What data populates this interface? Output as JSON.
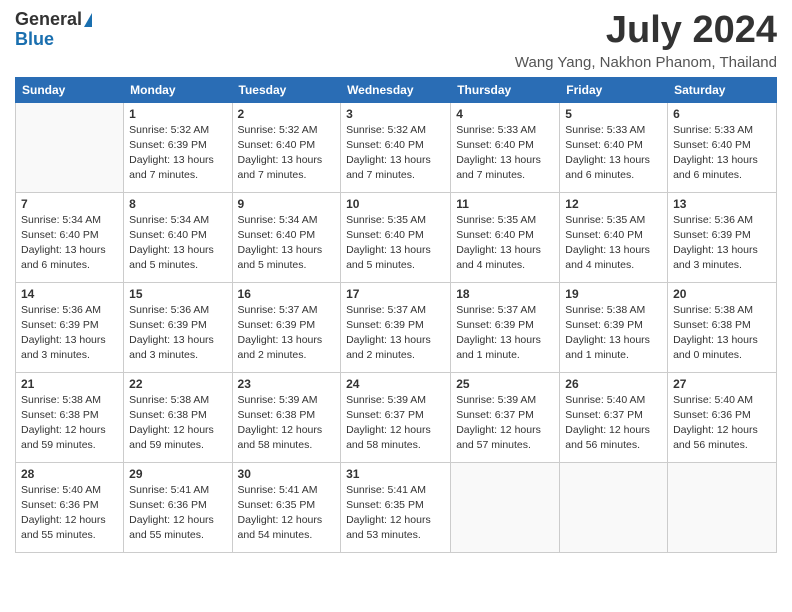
{
  "logo": {
    "general": "General",
    "blue": "Blue"
  },
  "title": {
    "month_year": "July 2024",
    "location": "Wang Yang, Nakhon Phanom, Thailand"
  },
  "weekdays": [
    "Sunday",
    "Monday",
    "Tuesday",
    "Wednesday",
    "Thursday",
    "Friday",
    "Saturday"
  ],
  "weeks": [
    [
      null,
      {
        "day": "1",
        "sunrise": "5:32 AM",
        "sunset": "6:39 PM",
        "daylight": "13 hours and 7 minutes."
      },
      {
        "day": "2",
        "sunrise": "5:32 AM",
        "sunset": "6:40 PM",
        "daylight": "13 hours and 7 minutes."
      },
      {
        "day": "3",
        "sunrise": "5:32 AM",
        "sunset": "6:40 PM",
        "daylight": "13 hours and 7 minutes."
      },
      {
        "day": "4",
        "sunrise": "5:33 AM",
        "sunset": "6:40 PM",
        "daylight": "13 hours and 7 minutes."
      },
      {
        "day": "5",
        "sunrise": "5:33 AM",
        "sunset": "6:40 PM",
        "daylight": "13 hours and 6 minutes."
      },
      {
        "day": "6",
        "sunrise": "5:33 AM",
        "sunset": "6:40 PM",
        "daylight": "13 hours and 6 minutes."
      }
    ],
    [
      {
        "day": "7",
        "sunrise": "5:34 AM",
        "sunset": "6:40 PM",
        "daylight": "13 hours and 6 minutes."
      },
      {
        "day": "8",
        "sunrise": "5:34 AM",
        "sunset": "6:40 PM",
        "daylight": "13 hours and 5 minutes."
      },
      {
        "day": "9",
        "sunrise": "5:34 AM",
        "sunset": "6:40 PM",
        "daylight": "13 hours and 5 minutes."
      },
      {
        "day": "10",
        "sunrise": "5:35 AM",
        "sunset": "6:40 PM",
        "daylight": "13 hours and 5 minutes."
      },
      {
        "day": "11",
        "sunrise": "5:35 AM",
        "sunset": "6:40 PM",
        "daylight": "13 hours and 4 minutes."
      },
      {
        "day": "12",
        "sunrise": "5:35 AM",
        "sunset": "6:40 PM",
        "daylight": "13 hours and 4 minutes."
      },
      {
        "day": "13",
        "sunrise": "5:36 AM",
        "sunset": "6:39 PM",
        "daylight": "13 hours and 3 minutes."
      }
    ],
    [
      {
        "day": "14",
        "sunrise": "5:36 AM",
        "sunset": "6:39 PM",
        "daylight": "13 hours and 3 minutes."
      },
      {
        "day": "15",
        "sunrise": "5:36 AM",
        "sunset": "6:39 PM",
        "daylight": "13 hours and 3 minutes."
      },
      {
        "day": "16",
        "sunrise": "5:37 AM",
        "sunset": "6:39 PM",
        "daylight": "13 hours and 2 minutes."
      },
      {
        "day": "17",
        "sunrise": "5:37 AM",
        "sunset": "6:39 PM",
        "daylight": "13 hours and 2 minutes."
      },
      {
        "day": "18",
        "sunrise": "5:37 AM",
        "sunset": "6:39 PM",
        "daylight": "13 hours and 1 minute."
      },
      {
        "day": "19",
        "sunrise": "5:38 AM",
        "sunset": "6:39 PM",
        "daylight": "13 hours and 1 minute."
      },
      {
        "day": "20",
        "sunrise": "5:38 AM",
        "sunset": "6:38 PM",
        "daylight": "13 hours and 0 minutes."
      }
    ],
    [
      {
        "day": "21",
        "sunrise": "5:38 AM",
        "sunset": "6:38 PM",
        "daylight": "12 hours and 59 minutes."
      },
      {
        "day": "22",
        "sunrise": "5:38 AM",
        "sunset": "6:38 PM",
        "daylight": "12 hours and 59 minutes."
      },
      {
        "day": "23",
        "sunrise": "5:39 AM",
        "sunset": "6:38 PM",
        "daylight": "12 hours and 58 minutes."
      },
      {
        "day": "24",
        "sunrise": "5:39 AM",
        "sunset": "6:37 PM",
        "daylight": "12 hours and 58 minutes."
      },
      {
        "day": "25",
        "sunrise": "5:39 AM",
        "sunset": "6:37 PM",
        "daylight": "12 hours and 57 minutes."
      },
      {
        "day": "26",
        "sunrise": "5:40 AM",
        "sunset": "6:37 PM",
        "daylight": "12 hours and 56 minutes."
      },
      {
        "day": "27",
        "sunrise": "5:40 AM",
        "sunset": "6:36 PM",
        "daylight": "12 hours and 56 minutes."
      }
    ],
    [
      {
        "day": "28",
        "sunrise": "5:40 AM",
        "sunset": "6:36 PM",
        "daylight": "12 hours and 55 minutes."
      },
      {
        "day": "29",
        "sunrise": "5:41 AM",
        "sunset": "6:36 PM",
        "daylight": "12 hours and 55 minutes."
      },
      {
        "day": "30",
        "sunrise": "5:41 AM",
        "sunset": "6:35 PM",
        "daylight": "12 hours and 54 minutes."
      },
      {
        "day": "31",
        "sunrise": "5:41 AM",
        "sunset": "6:35 PM",
        "daylight": "12 hours and 53 minutes."
      },
      null,
      null,
      null
    ]
  ]
}
